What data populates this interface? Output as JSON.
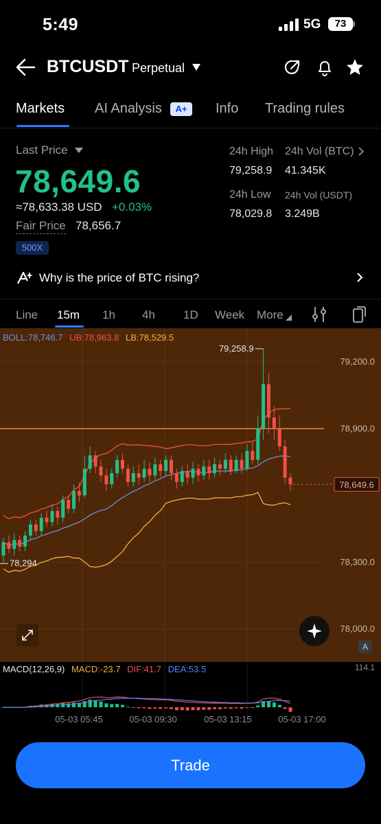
{
  "status_bar": {
    "time": "5:49",
    "network": "5G",
    "battery": "73"
  },
  "header": {
    "symbol": "BTCUSDT",
    "contract_type": "Perpetual"
  },
  "tabs": [
    {
      "label": "Markets"
    },
    {
      "label": "AI Analysis",
      "badge": "A+"
    },
    {
      "label": "Info"
    },
    {
      "label": "Trading rules"
    }
  ],
  "price": {
    "last_label": "Last Price",
    "last_price": "78,649.6",
    "usd_equiv": "≈78,633.38 USD",
    "change": "+0.03%",
    "fair_label": "Fair Price",
    "fair_value": "78,656.7",
    "leverage": "500X"
  },
  "stats": {
    "high_label": "24h High",
    "high_value": "79,258.9",
    "vol_btc_label": "24h Vol (BTC)",
    "vol_btc_value": "41.345K",
    "low_label": "24h Low",
    "low_value": "78,029.8",
    "vol_usdt_label": "24h Vol  (USDT)",
    "vol_usdt_value": "3.249B"
  },
  "insight": {
    "text": "Why is the price of BTC rising?"
  },
  "intervals": [
    "Line",
    "15m",
    "1h",
    "4h",
    "1D",
    "Week",
    "More"
  ],
  "active_interval": "15m",
  "indicators": {
    "boll": "BOLL:78,746.7",
    "ub": "UB:78,963.8",
    "lb": "LB:78,529.5",
    "macd": "MACD(12,26,9)",
    "macd_val": "MACD:-23.7",
    "dif": "DIF:41.7",
    "dea": "DEA:53.5"
  },
  "chart_data": {
    "type": "candlestick",
    "y_axis_labels": [
      "79,200.0",
      "78,900.0",
      "78,300.0",
      "78,000.0"
    ],
    "y_ticks": [
      79200,
      78900,
      78300,
      78000
    ],
    "high_marker": "79,258.9",
    "low_marker": "78,294",
    "current_price": "78,649.6",
    "mark_line": 78900,
    "macd_scale_label": "114.1",
    "x_labels": [
      "05-03 05:45",
      "05-03 09:30",
      "05-03 13:15",
      "05-03 17:00"
    ],
    "candles": [
      [
        78330,
        78390,
        78300,
        78410
      ],
      [
        78390,
        78360,
        78340,
        78420
      ],
      [
        78360,
        78400,
        78330,
        78430
      ],
      [
        78400,
        78370,
        78350,
        78420
      ],
      [
        78370,
        78420,
        78350,
        78440
      ],
      [
        78420,
        78470,
        78400,
        78490
      ],
      [
        78470,
        78440,
        78420,
        78490
      ],
      [
        78440,
        78500,
        78420,
        78520
      ],
      [
        78500,
        78480,
        78460,
        78530
      ],
      [
        78480,
        78530,
        78460,
        78560
      ],
      [
        78530,
        78500,
        78470,
        78550
      ],
      [
        78500,
        78580,
        78480,
        78600
      ],
      [
        78580,
        78540,
        78520,
        78600
      ],
      [
        78540,
        78620,
        78520,
        78650
      ],
      [
        78620,
        78600,
        78570,
        78660
      ],
      [
        78600,
        78720,
        78590,
        78780
      ],
      [
        78720,
        78780,
        78700,
        78820
      ],
      [
        78780,
        78730,
        78700,
        78800
      ],
      [
        78730,
        78690,
        78660,
        78760
      ],
      [
        78690,
        78650,
        78620,
        78720
      ],
      [
        78650,
        78700,
        78630,
        78720
      ],
      [
        78700,
        78760,
        78680,
        78780
      ],
      [
        78760,
        78720,
        78700,
        78790
      ],
      [
        78720,
        78660,
        78640,
        78740
      ],
      [
        78660,
        78700,
        78640,
        78730
      ],
      [
        78700,
        78680,
        78650,
        78740
      ],
      [
        78680,
        78720,
        78660,
        78760
      ],
      [
        78720,
        78690,
        78660,
        78750
      ],
      [
        78690,
        78740,
        78670,
        78770
      ],
      [
        78740,
        78710,
        78680,
        78760
      ],
      [
        78710,
        78760,
        78690,
        78780
      ],
      [
        78760,
        78700,
        78670,
        78780
      ],
      [
        78700,
        78660,
        78630,
        78720
      ],
      [
        78660,
        78710,
        78640,
        78730
      ],
      [
        78710,
        78680,
        78650,
        78740
      ],
      [
        78680,
        78720,
        78650,
        78750
      ],
      [
        78720,
        78690,
        78660,
        78740
      ],
      [
        78690,
        78730,
        78670,
        78760
      ],
      [
        78730,
        78700,
        78670,
        78760
      ],
      [
        78700,
        78740,
        78680,
        78770
      ],
      [
        78740,
        78720,
        78690,
        78760
      ],
      [
        78720,
        78760,
        78700,
        78790
      ],
      [
        78760,
        78710,
        78690,
        78780
      ],
      [
        78710,
        78760,
        78700,
        78780
      ],
      [
        78760,
        78720,
        78700,
        78790
      ],
      [
        78720,
        78800,
        78710,
        78830
      ],
      [
        78800,
        78760,
        78740,
        78840
      ],
      [
        78760,
        78900,
        78740,
        78960
      ],
      [
        78900,
        79100,
        78850,
        79258.9
      ],
      [
        79100,
        78950,
        78880,
        79150
      ],
      [
        78950,
        78900,
        78850,
        79000
      ],
      [
        78900,
        78820,
        78800,
        78960
      ],
      [
        78820,
        78680,
        78650,
        78850
      ],
      [
        78680,
        78649.6,
        78620,
        78700
      ]
    ]
  },
  "trade_button": {
    "label": "Trade"
  },
  "colors": {
    "up": "#22c08a",
    "down": "#f0504a",
    "accent": "#1a73ff",
    "chart_bg": "#4d2708"
  }
}
